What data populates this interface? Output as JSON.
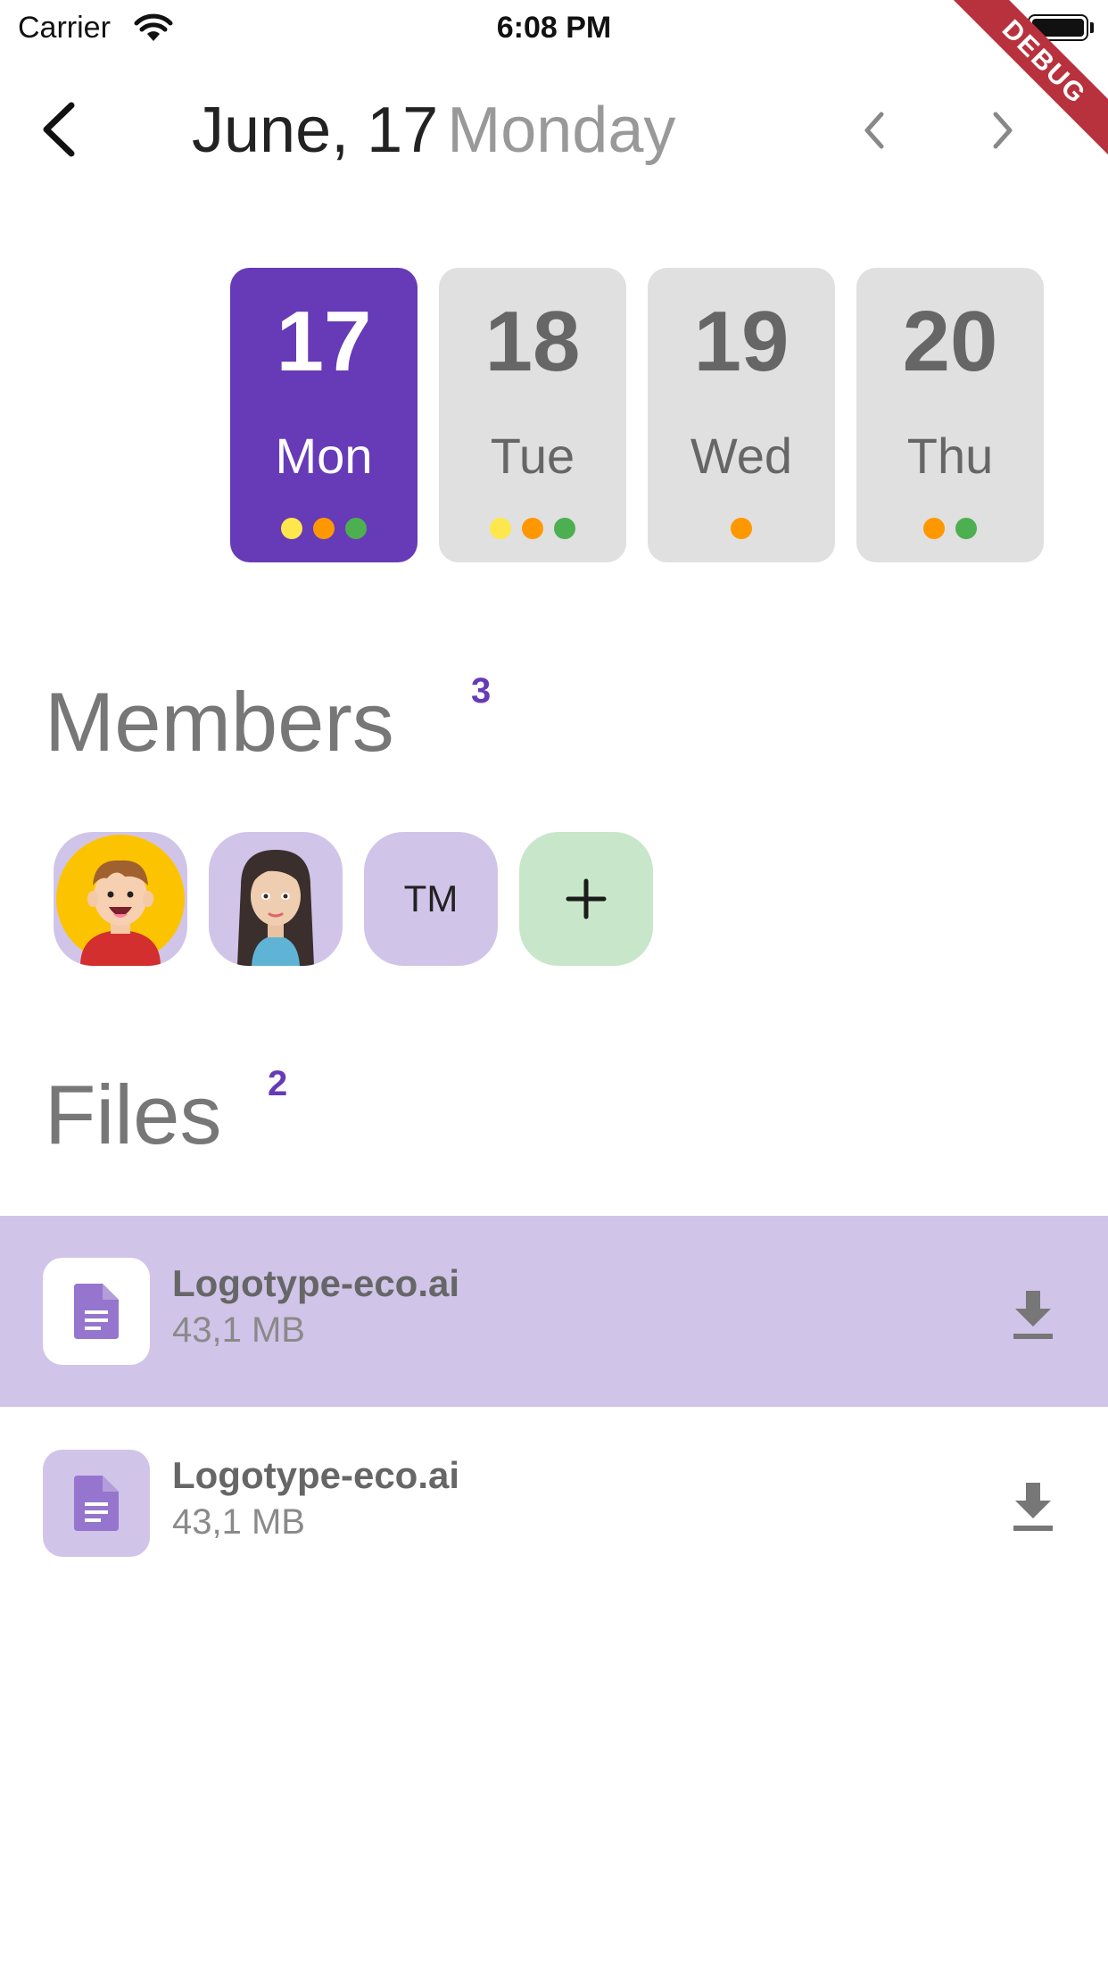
{
  "status_bar": {
    "carrier": "Carrier",
    "time": "6:08 PM"
  },
  "debug_banner": "DEBUG",
  "header": {
    "date": "June, 17",
    "day": "Monday"
  },
  "days": [
    {
      "num": "17",
      "name": "Mon",
      "selected": true,
      "dots": [
        "#fde74c",
        "#ff9800",
        "#4caf50"
      ]
    },
    {
      "num": "18",
      "name": "Tue",
      "selected": false,
      "dots": [
        "#fde74c",
        "#ff9800",
        "#4caf50"
      ]
    },
    {
      "num": "19",
      "name": "Wed",
      "selected": false,
      "dots": [
        "#ff9800"
      ]
    },
    {
      "num": "20",
      "name": "Thu",
      "selected": false,
      "dots": [
        "#ff9800",
        "#4caf50"
      ]
    }
  ],
  "members": {
    "title": "Members",
    "count": "3",
    "initials": "TM"
  },
  "files": {
    "title": "Files",
    "count": "2",
    "items": [
      {
        "name": "Logotype-eco.ai",
        "size": "43,1 MB"
      },
      {
        "name": "Logotype-eco.ai",
        "size": "43,1 MB"
      }
    ]
  },
  "colors": {
    "accent": "#673ab7",
    "light_accent": "#d1c4e9",
    "add_green": "#c8e6c9",
    "file_icon": "#9575cd"
  }
}
